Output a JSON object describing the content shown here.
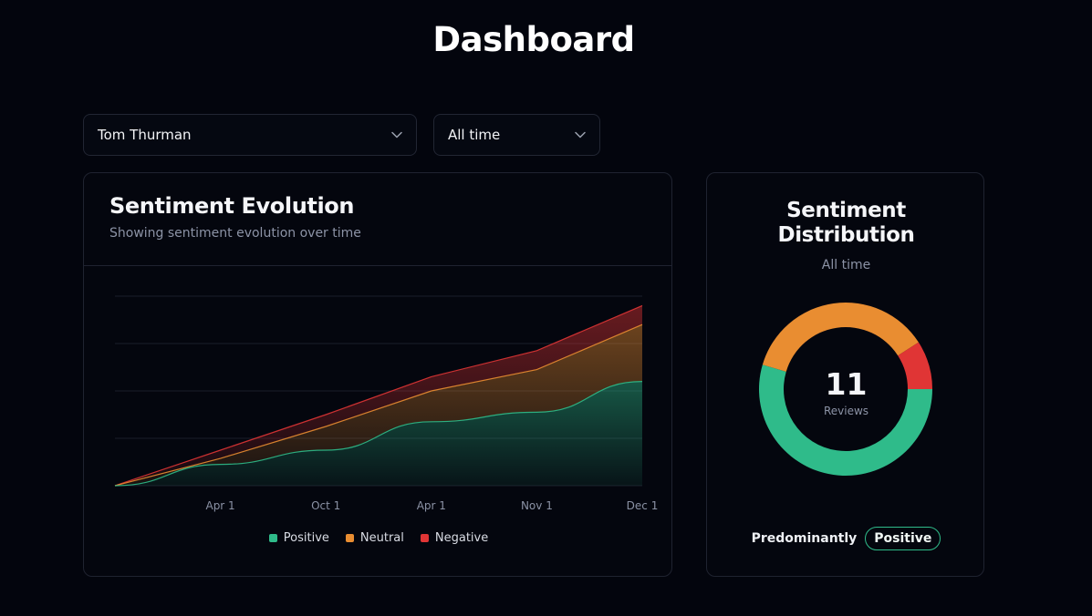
{
  "page": {
    "title": "Dashboard"
  },
  "filters": {
    "user": {
      "value": "Tom Thurman",
      "icon": "chevron-down-icon"
    },
    "range": {
      "value": "All time",
      "icon": "chevron-down-icon"
    }
  },
  "evolution": {
    "title": "Sentiment Evolution",
    "subtitle": "Showing sentiment evolution over time"
  },
  "distribution": {
    "title_line1": "Sentiment",
    "title_line2": "Distribution",
    "subtitle": "All time",
    "total": "11",
    "total_label": "Reviews",
    "predominant_label": "Predominantly",
    "predominant_value": "Positive"
  },
  "colors": {
    "positive": "#2fbb8a",
    "neutral": "#e98d31",
    "negative": "#e03535",
    "background": "#03050d"
  },
  "chart_data": [
    {
      "type": "area",
      "stacked": true,
      "x": [
        "",
        "Apr 1",
        "Oct 1",
        "Apr 1",
        "Nov 1",
        "Dec 1"
      ],
      "x_tick_labels": [
        "Apr 1",
        "Oct 1",
        "Apr 1",
        "Nov 1",
        "Dec 1"
      ],
      "series": [
        {
          "name": "Positive",
          "color": "#2fbb8a",
          "values": [
            0,
            0.9,
            1.5,
            2.7,
            3.1,
            4.4
          ]
        },
        {
          "name": "Neutral",
          "color": "#e98d31",
          "values": [
            0,
            0.25,
            1.0,
            1.3,
            1.8,
            2.4
          ]
        },
        {
          "name": "Negative",
          "color": "#e03535",
          "values": [
            0,
            0.35,
            0.5,
            0.6,
            0.8,
            0.8
          ]
        }
      ],
      "grid": true,
      "legend": "bottom-center"
    },
    {
      "type": "pie",
      "donut": true,
      "categories": [
        "Positive",
        "Neutral",
        "Negative"
      ],
      "values": [
        6,
        4,
        1
      ],
      "colors": [
        "#2fbb8a",
        "#e98d31",
        "#e03535"
      ]
    }
  ]
}
